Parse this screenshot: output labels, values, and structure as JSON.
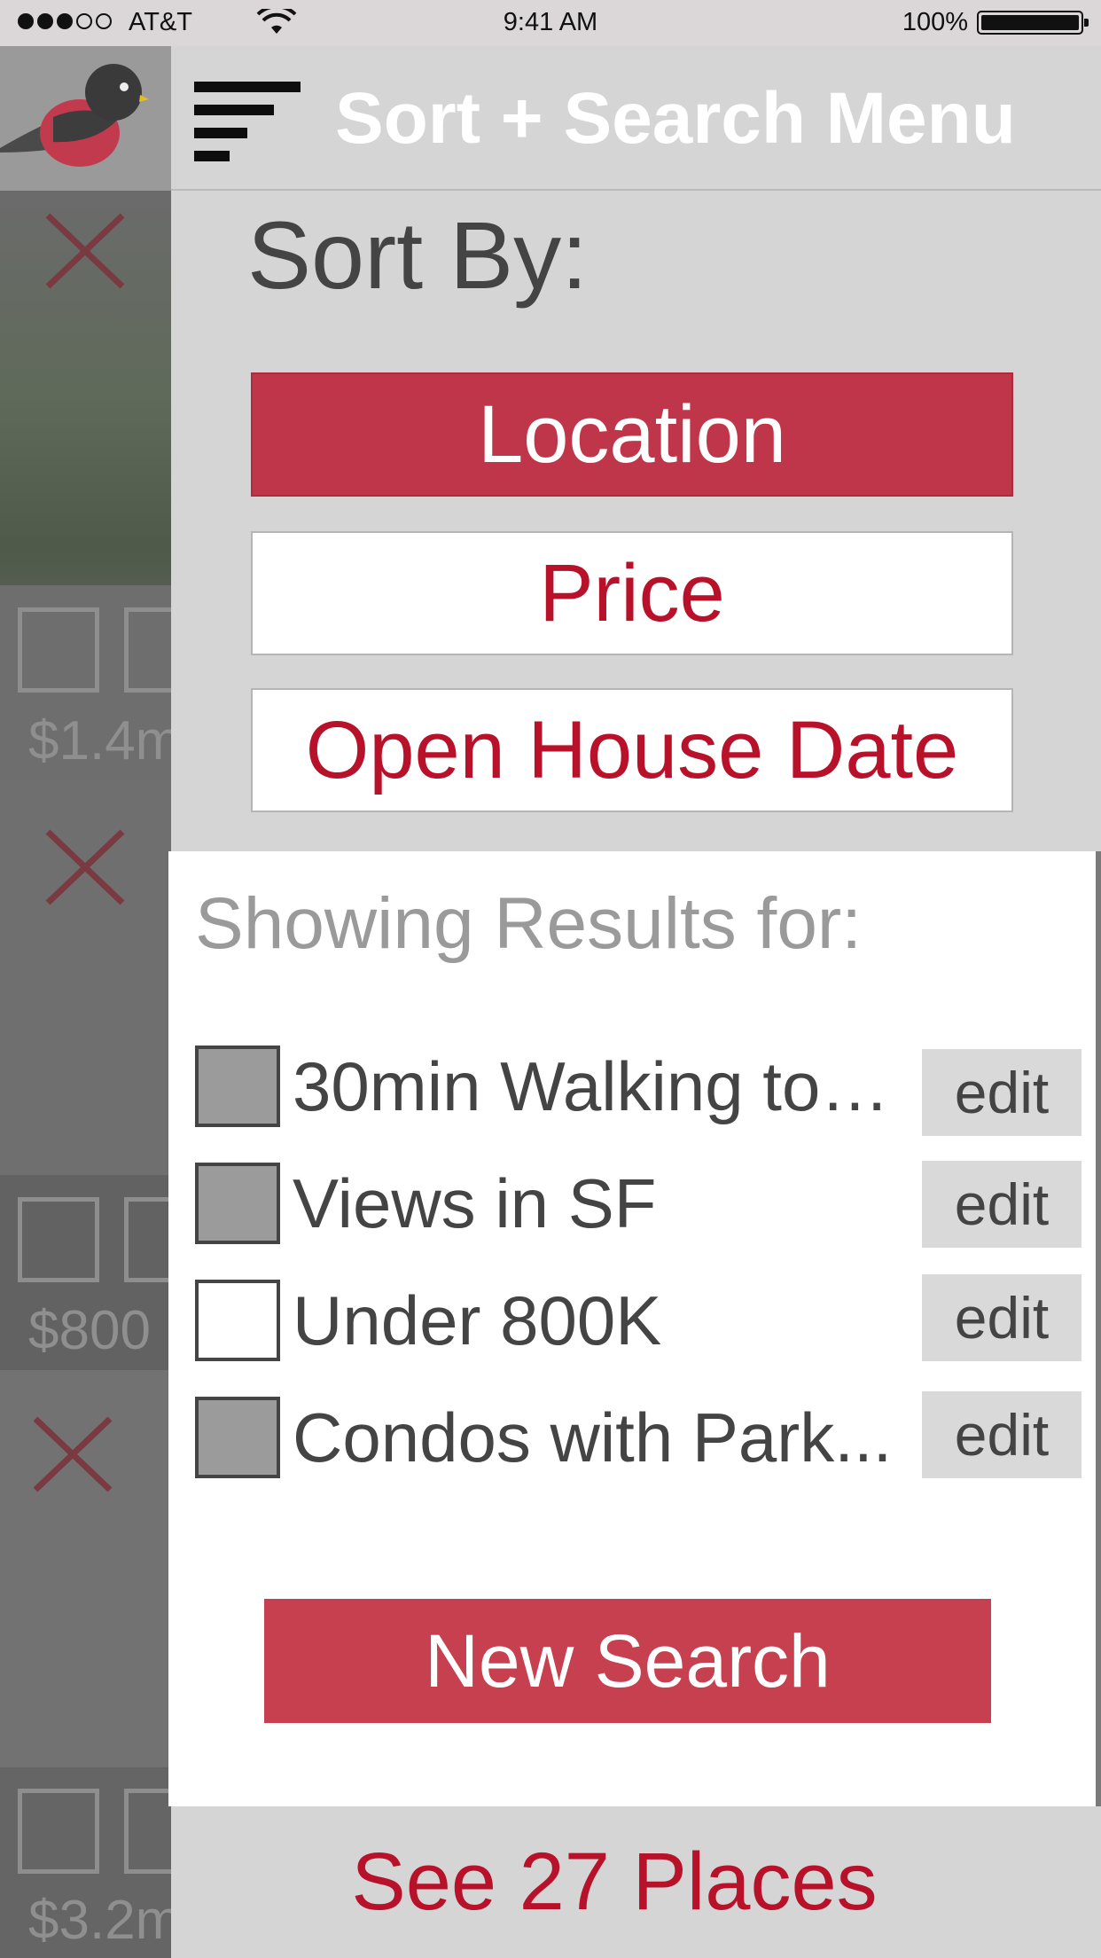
{
  "status_bar": {
    "carrier": "AT&T",
    "time": "9:41 AM",
    "battery": "100%"
  },
  "background": {
    "prices": [
      "$1.4m",
      "$800",
      "$3.2m"
    ]
  },
  "drawer": {
    "title": "Sort + Search Menu",
    "sort_label": "Sort By:",
    "sort_options": [
      {
        "label": "Location",
        "selected": true
      },
      {
        "label": "Price",
        "selected": false
      },
      {
        "label": "Open House Date",
        "selected": false
      }
    ],
    "results_heading": "Showing Results for:",
    "filters": [
      {
        "label": "30min Walking to…",
        "checked": true,
        "edit_label": "edit"
      },
      {
        "label": "Views in SF",
        "checked": true,
        "edit_label": "edit"
      },
      {
        "label": "Under 800K",
        "checked": false,
        "edit_label": "edit"
      },
      {
        "label": "Condos with Park...",
        "checked": true,
        "edit_label": "edit"
      }
    ],
    "new_search_label": "New Search",
    "see_places_label": "See 27 Places"
  },
  "colors": {
    "accent": "#bf3549",
    "accent_text": "#b8122b",
    "panel_gray": "#d5d5d5"
  }
}
